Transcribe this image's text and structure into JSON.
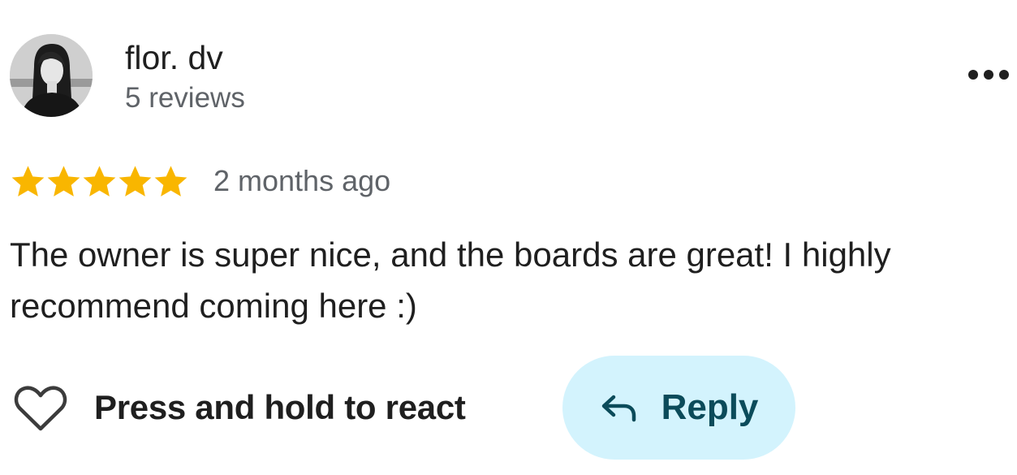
{
  "review": {
    "author": {
      "name": "flor. dv",
      "review_count": "5 reviews",
      "avatar_icon": "profile-photo"
    },
    "more_icon": "more-horizontal-icon",
    "rating": {
      "stars": 5,
      "max": 5,
      "star_color": "#f9b600"
    },
    "date": "2 months ago",
    "text": "The owner is super nice, and the boards are great! I highly recommend coming here :)",
    "actions": {
      "react_icon": "heart-outline-icon",
      "react_label": "Press and hold to react",
      "reply_icon": "reply-arrow-icon",
      "reply_label": "Reply",
      "reply_bg": "#d3f3fd",
      "reply_text_color": "#0b4b5a"
    }
  }
}
